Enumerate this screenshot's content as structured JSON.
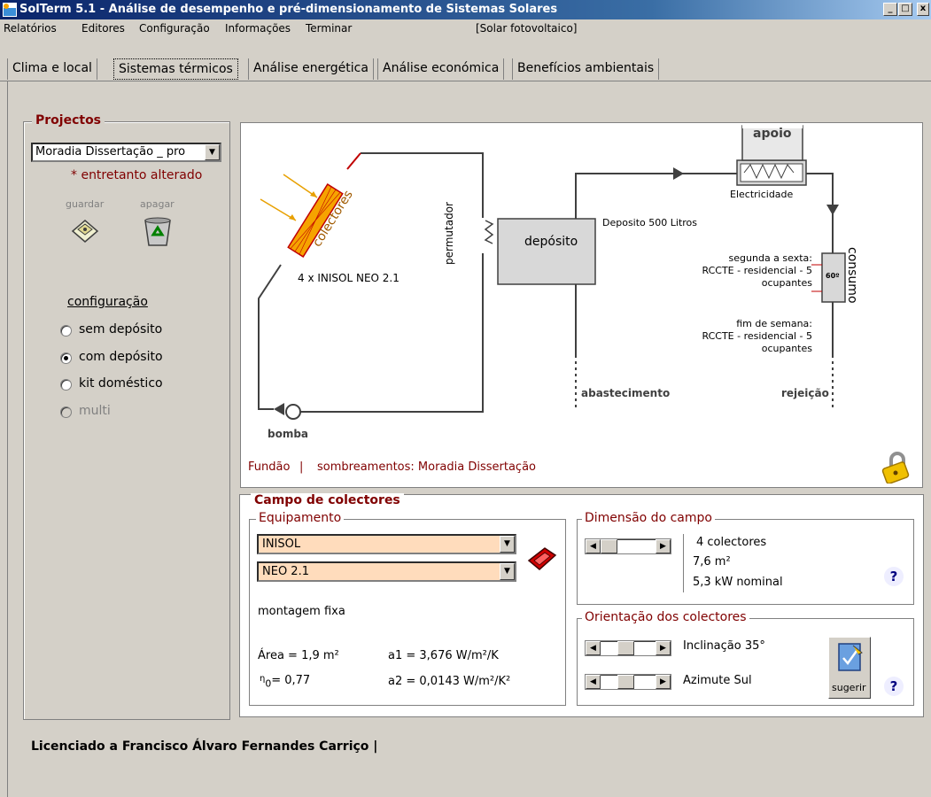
{
  "window": {
    "title": "SolTerm 5.1 - Análise de desempenho e pré-dimensionamento de Sistemas Solares",
    "minimize": "_",
    "maximize": "□",
    "close": "x"
  },
  "menu": {
    "items": [
      "Relatórios",
      "Editores",
      "Configuração",
      "Informações",
      "Terminar"
    ],
    "mode": "[Solar fotovoltaico]"
  },
  "tabs": [
    {
      "label": "Clima e local",
      "active": false
    },
    {
      "label": "Sistemas térmicos",
      "active": true
    },
    {
      "label": "Análise energética",
      "active": false
    },
    {
      "label": "Análise económica",
      "active": false
    },
    {
      "label": "Benefícios ambientais",
      "active": false
    }
  ],
  "projects": {
    "legend": "Projectos",
    "selected": "Moradia Dissertação _ pro",
    "changed_note": "* entretanto alterado",
    "save_label": "guardar",
    "delete_label": "apagar",
    "config_title": "configuração",
    "options": [
      {
        "label": "sem depósito",
        "checked": false,
        "enabled": true
      },
      {
        "label": "com depósito",
        "checked": true,
        "enabled": true
      },
      {
        "label": "kit doméstico",
        "checked": false,
        "enabled": true
      },
      {
        "label": "multi",
        "checked": false,
        "enabled": false
      }
    ]
  },
  "diagram": {
    "collectors_label": "colectores",
    "collectors_model": "4 x INISOL NEO 2.1",
    "exchanger_label": "permutador",
    "tank_label": "depósito",
    "tank_size": "Deposito 500 Litros",
    "backup_label": "apoio",
    "backup_source": "Electricidade",
    "consumption_label": "consumo",
    "temperature": "60º",
    "weekday_title": "segunda a sexta:",
    "weekday_line1": "RCCTE - residencial - 5",
    "weekday_line2": "ocupantes",
    "weekend_title": "fim de semana:",
    "weekend_line1": "RCCTE - residencial - 5",
    "weekend_line2": "ocupantes",
    "supply_label": "abastecimento",
    "rejection_label": "rejeição",
    "pump_label": "bomba",
    "location_link": "Fundão",
    "separator": "|",
    "shading_link": "sombreamentos: Moradia Dissertação"
  },
  "campo": {
    "legend": "Campo de colectores",
    "equipment": {
      "legend": "Equipamento",
      "manufacturer": "INISOL",
      "model": "NEO 2.1",
      "mounting": "montagem fixa",
      "area": "Área = 1,9 m²",
      "a1": "a1 = 3,676  W/m²/K",
      "eta_symbol": "η",
      "eta_sub": "0",
      "eta_value": "= 0,77",
      "a2": "a2 = 0,0143 W/m²/K²"
    },
    "dimension": {
      "legend": "Dimensão do campo",
      "count": "4 colectores",
      "area": "7,6 m²",
      "power": "5,3 kW nominal",
      "help": "?"
    },
    "orientation": {
      "legend": "Orientação dos colectores",
      "tilt": "Inclinação 35°",
      "azimuth": "Azimute Sul",
      "suggest": "sugerir",
      "help": "?"
    }
  },
  "license": "Licenciado a Francisco Álvaro Fernandes Carriço |",
  "colors": {
    "accent_red": "#800000",
    "combo_bg": "#ffdcbc",
    "collector_fill": "#f6a300",
    "pipe_red": "#c00000"
  }
}
